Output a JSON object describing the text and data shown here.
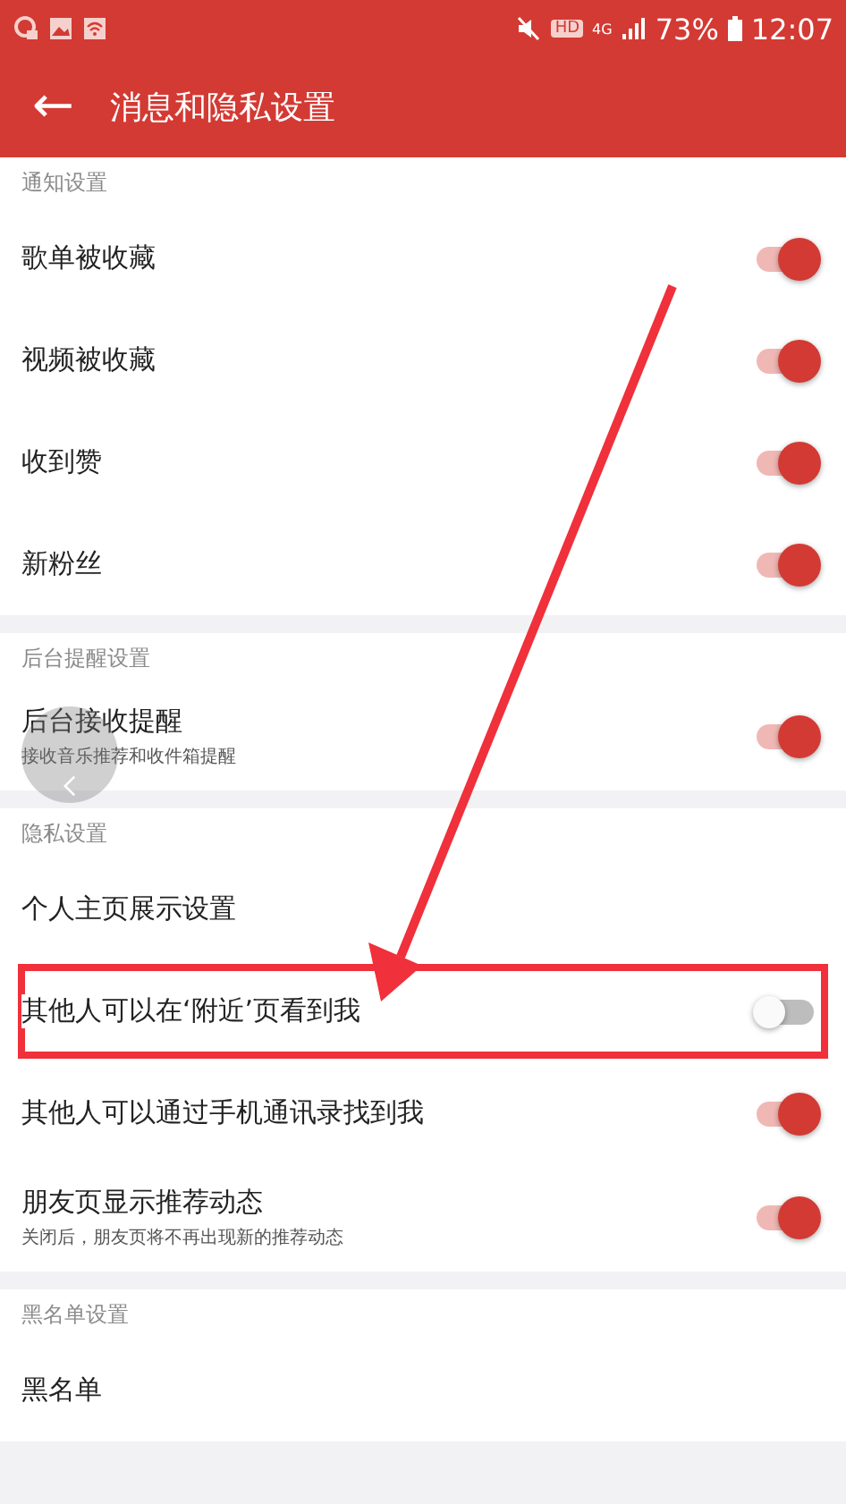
{
  "status_bar": {
    "hd": "HD",
    "network": "4G",
    "battery": "73%",
    "time": "12:07"
  },
  "toolbar": {
    "back": "←",
    "title": "消息和隐私设置"
  },
  "sections": [
    {
      "header": "通知设置",
      "rows": [
        {
          "label": "歌单被收藏",
          "on": true,
          "highlighted": false
        },
        {
          "label": "视频被收藏",
          "on": true,
          "highlighted": false
        },
        {
          "label": "收到赞",
          "on": true,
          "highlighted": false
        },
        {
          "label": "新粉丝",
          "on": true,
          "highlighted": false
        }
      ]
    },
    {
      "header": "后台提醒设置",
      "rows": [
        {
          "label": "后台接收提醒",
          "subtitle": "接收音乐推荐和收件箱提醒",
          "on": true,
          "highlighted": false
        }
      ]
    },
    {
      "header": "隐私设置",
      "rows": [
        {
          "label": "个人主页展示设置",
          "highlighted": false
        },
        {
          "label": "其他人可以在‘附近’页看到我",
          "on": false,
          "highlighted": true
        },
        {
          "label": "其他人可以通过手机通讯录找到我",
          "on": true,
          "highlighted": false
        },
        {
          "label": "朋友页显示推荐动态",
          "subtitle": "关闭后，朋友页将不再出现新的推荐动态",
          "on": true,
          "highlighted": false
        }
      ]
    },
    {
      "header": "黑名单设置",
      "rows": [
        {
          "label": "黑名单",
          "highlighted": false
        }
      ]
    }
  ]
}
